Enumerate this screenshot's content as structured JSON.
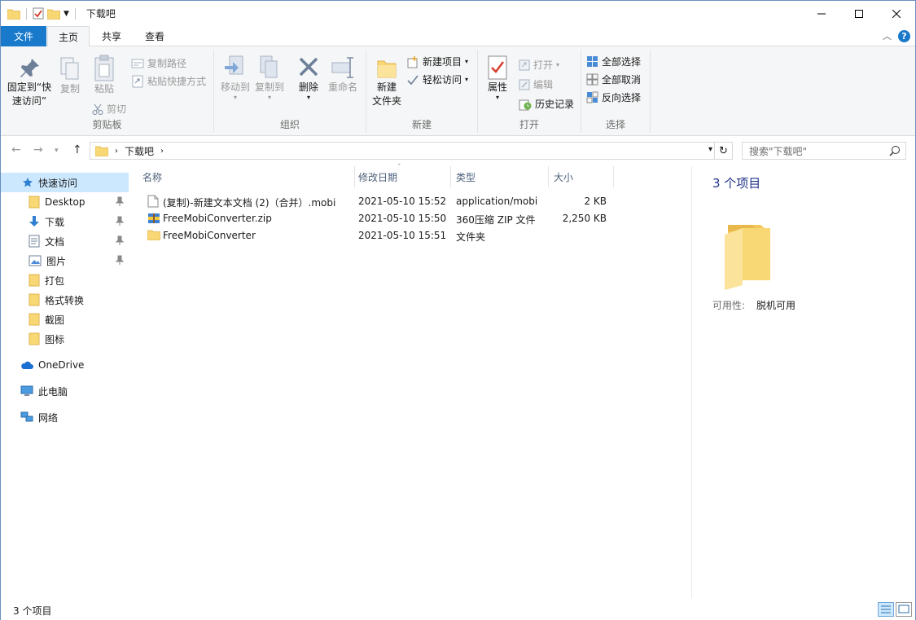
{
  "window": {
    "title": "下载吧"
  },
  "tabs": {
    "file": "文件",
    "home": "主页",
    "share": "共享",
    "view": "查看"
  },
  "ribbon": {
    "clipboard": {
      "label": "剪贴板",
      "pin_line1": "固定到“快",
      "pin_line2": "速访问”",
      "copy": "复制",
      "paste": "粘贴",
      "copy_path": "复制路径",
      "paste_shortcut": "粘贴快捷方式",
      "cut": "剪切"
    },
    "organize": {
      "label": "组织",
      "move_to": "移动到",
      "copy_to": "复制到",
      "delete": "删除",
      "rename": "重命名"
    },
    "new": {
      "label": "新建",
      "new_folder_line1": "新建",
      "new_folder_line2": "文件夹",
      "new_item": "新建项目",
      "easy_access": "轻松访问"
    },
    "open": {
      "label": "打开",
      "properties": "属性",
      "open": "打开",
      "edit": "编辑",
      "history": "历史记录"
    },
    "select": {
      "label": "选择",
      "select_all": "全部选择",
      "select_none": "全部取消",
      "invert": "反向选择"
    }
  },
  "address": {
    "crumb": "下载吧",
    "search_placeholder": "搜索\"下载吧\""
  },
  "nav": {
    "quick_access": "快速访问",
    "items": [
      {
        "label": "Desktop",
        "pinned": true
      },
      {
        "label": "下载",
        "pinned": true
      },
      {
        "label": "文档",
        "pinned": true
      },
      {
        "label": "图片",
        "pinned": true
      },
      {
        "label": "打包",
        "pinned": false
      },
      {
        "label": "格式转换",
        "pinned": false
      },
      {
        "label": "截图",
        "pinned": false
      },
      {
        "label": "图标",
        "pinned": false
      }
    ],
    "onedrive": "OneDrive",
    "this_pc": "此电脑",
    "network": "网络"
  },
  "columns": {
    "name": "名称",
    "modified": "修改日期",
    "type": "类型",
    "size": "大小"
  },
  "files": [
    {
      "name": "(复制)-新建文本文档 (2)（合并）.mobi",
      "modified": "2021-05-10 15:52",
      "type": "application/mobi",
      "size": "2 KB",
      "icon": "file-icon"
    },
    {
      "name": "FreeMobiConverter.zip",
      "modified": "2021-05-10 15:50",
      "type": "360压缩 ZIP 文件",
      "size": "2,250 KB",
      "icon": "zip-icon"
    },
    {
      "name": "FreeMobiConverter",
      "modified": "2021-05-10 15:51",
      "type": "文件夹",
      "size": "",
      "icon": "folder-icon"
    }
  ],
  "details": {
    "count": "3 个项目",
    "availability_label": "可用性:",
    "availability_value": "脱机可用"
  },
  "status": {
    "count": "3 个项目"
  },
  "colors": {
    "accent": "#1979ca",
    "selection": "#cce8ff",
    "folder": "#f8d775"
  }
}
